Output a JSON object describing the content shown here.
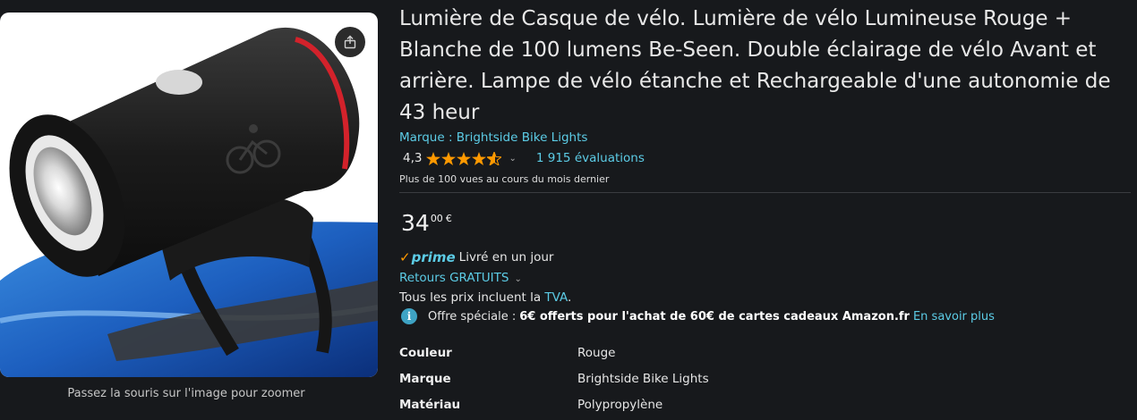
{
  "product": {
    "title": "Lumière de Casque de vélo. Lumière de vélo Lumineuse Rouge + Blanche de 100 lumens Be-Seen. Double éclairage de vélo Avant et arrière. Lampe de vélo étanche et Rechargeable d'une autonomie de 43 heur",
    "brand_text": "Marque : Brightside Bike Lights",
    "rating_value": "4,3",
    "rating_stars": 4.3,
    "rating_count": "1 915 évaluations",
    "views_text": "Plus de 100 vues au cours du mois dernier"
  },
  "image": {
    "zoom_hint": "Passez la souris sur l'image pour zoomer",
    "icon": "share-icon"
  },
  "price": {
    "whole": "34",
    "fraction": "00",
    "currency": "€"
  },
  "delivery": {
    "prime_check": "✓",
    "prime_word": "prime",
    "prime_text": "Livré en un jour",
    "returns_label": "Retours GRATUITS",
    "vat_prefix": "Tous les prix incluent la ",
    "vat_link": "TVA",
    "vat_suffix": "."
  },
  "offer": {
    "icon": "info-icon",
    "label": "Offre spéciale :",
    "bold": "6€ offerts pour l'achat de 60€ de cartes cadeaux Amazon.fr",
    "link": "En savoir plus"
  },
  "specs": [
    {
      "key": "Couleur",
      "value": "Rouge"
    },
    {
      "key": "Marque",
      "value": "Brightside Bike Lights"
    },
    {
      "key": "Matériau",
      "value": "Polypropylène"
    }
  ],
  "colors": {
    "background": "#17191c",
    "link": "#5ccce6",
    "star": "#ff9900",
    "prime_check": "#ff9900"
  }
}
